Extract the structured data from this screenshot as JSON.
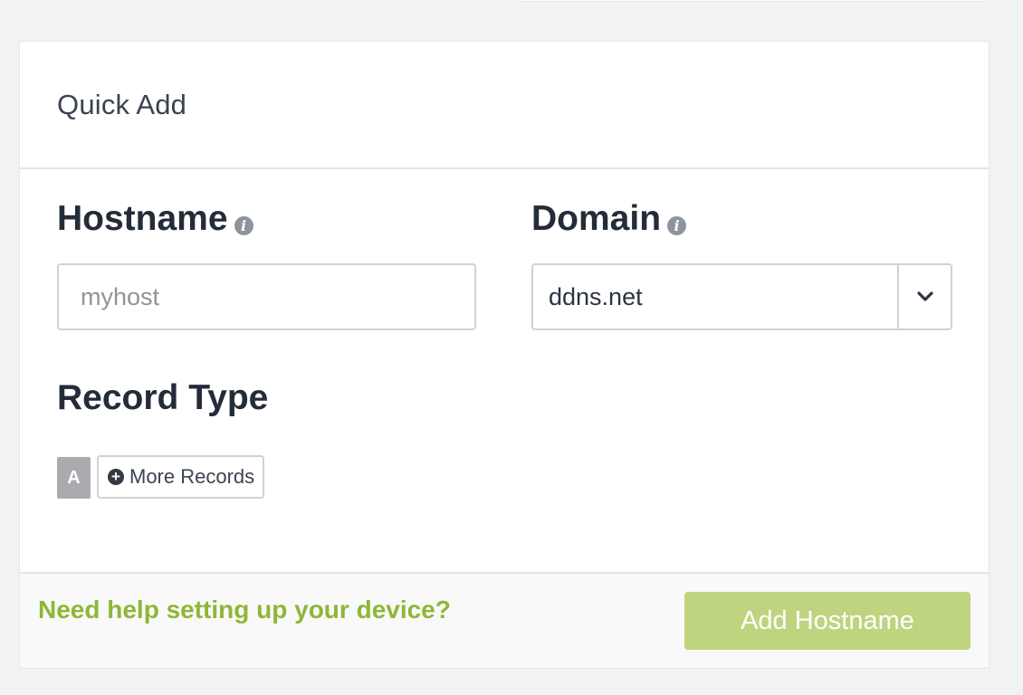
{
  "quick_add": {
    "title": "Quick Add",
    "hostname": {
      "label": "Hostname",
      "value": "",
      "placeholder": "myhost",
      "info_icon": "info-icon"
    },
    "domain": {
      "label": "Domain",
      "selected": "ddns.net",
      "info_icon": "info-icon",
      "caret_icon": "chevron-down-icon"
    },
    "record_type": {
      "label": "Record Type",
      "selected": "A",
      "more_label": "More Records",
      "more_icon": "plus-circle-icon"
    },
    "footer": {
      "help_text": "Need help setting up your device?",
      "submit_label": "Add Hostname"
    }
  },
  "colors": {
    "accent_green": "#8fb637",
    "button_green": "#bed47f",
    "record_badge_gray": "#a9abae"
  }
}
